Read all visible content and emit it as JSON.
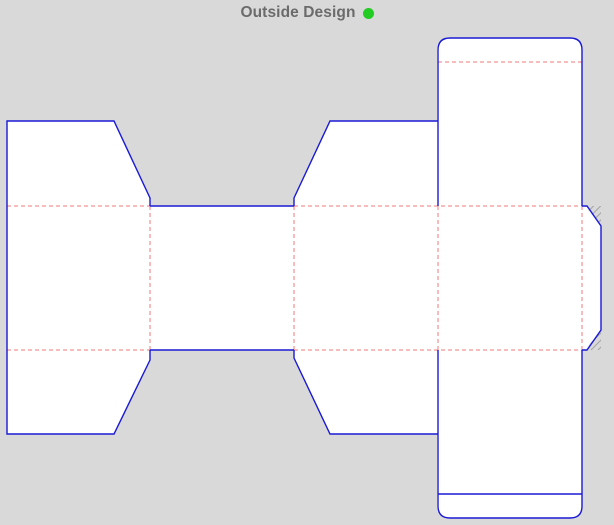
{
  "header": {
    "title": "Outside Design",
    "status_color": "#22cc22",
    "status_icon": "status-dot-icon"
  },
  "colors": {
    "background": "#d9d9d9",
    "panel_fill": "#ffffff",
    "cut_line": "#1a1ad6",
    "fold_line": "#f07878",
    "glue_hatch": "#9a9a9a"
  }
}
